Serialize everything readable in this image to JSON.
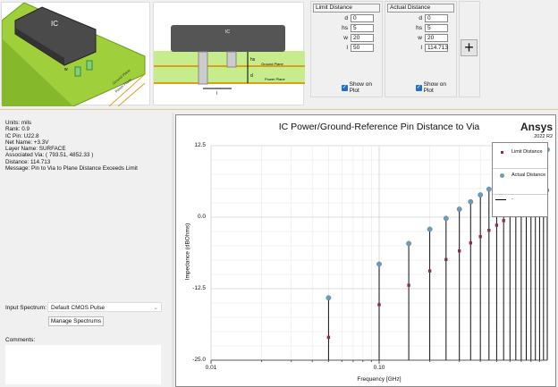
{
  "images": {
    "ic_label": "IC",
    "ground_plane": "Ground Plane",
    "power_plane": "Power Plane",
    "w": "w",
    "hs": "hs",
    "d": "d",
    "l": "l"
  },
  "limit_distance": {
    "title": "Limit Distance",
    "fields": [
      {
        "label": "d",
        "value": "0"
      },
      {
        "label": "hs",
        "value": "5"
      },
      {
        "label": "w",
        "value": "20"
      },
      {
        "label": "l",
        "value": "50"
      }
    ],
    "show_on_plot": "Show on Plot",
    "checked": true
  },
  "actual_distance": {
    "title": "Actual Distance",
    "fields": [
      {
        "label": "d",
        "value": "0"
      },
      {
        "label": "hs",
        "value": "5"
      },
      {
        "label": "w",
        "value": "20"
      },
      {
        "label": "l",
        "value": "114.713"
      }
    ],
    "show_on_plot": "Show on Plot",
    "checked": true
  },
  "add_button": {
    "icon": "plus-icon",
    "label": "+"
  },
  "info": [
    "Units: mils",
    "Rank: 0.9",
    "IC Pin: U22.8",
    "Net Name: +3.3V",
    "Layer Name: SURFACE",
    "Associated Via: ( 793.51, 4852.33 )",
    "Distance: 114.713",
    "Message: Pin to Via to Plane Distance Exceeds Limit"
  ],
  "input_spectrum": {
    "label": "Input Spectrum:",
    "value": "Default CMOS Pulse"
  },
  "manage_button": "Manage Spectrums",
  "comments": {
    "label": "Comments:",
    "value": ""
  },
  "brand": {
    "name": "Ansys",
    "version": "2022 R2"
  },
  "chart_data": {
    "type": "scatter",
    "title": "IC Power/Ground-Reference Pin Distance to Via",
    "xlabel": "Frequency [GHz]",
    "ylabel": "Impedance (dBOhms)",
    "xscale": "log",
    "xlim": [
      0.01,
      1.0
    ],
    "ylim": [
      -25,
      12.5
    ],
    "xticks": [
      "0.01",
      "0.10"
    ],
    "yticks": [
      "12.5",
      "0.0",
      "-12.5",
      "-25.0"
    ],
    "grid": true,
    "legend_position": "top-right",
    "x": [
      0.05,
      0.1,
      0.15,
      0.2,
      0.25,
      0.3,
      0.35,
      0.4,
      0.45,
      0.5,
      0.55,
      0.6,
      0.65,
      0.7,
      0.75,
      0.8,
      0.85,
      0.9,
      0.95,
      1.0
    ],
    "series": [
      {
        "name": "Limit Distance",
        "color": "#8b2e4a",
        "marker": "square",
        "values": [
          -21.0,
          -15.3,
          -11.9,
          -9.4,
          -7.4,
          -5.9,
          -4.5,
          -3.4,
          -2.3,
          -1.4,
          -0.6,
          0.3,
          1.0,
          1.6,
          2.2,
          2.8,
          3.3,
          3.8,
          4.2,
          4.7
        ]
      },
      {
        "name": "Actual Distance",
        "color": "#6f9bb5",
        "marker": "circle",
        "values": [
          -14.1,
          -8.2,
          -4.6,
          -2.1,
          -0.2,
          1.4,
          2.7,
          3.9,
          4.9,
          5.7,
          6.5,
          7.4,
          8.1,
          8.7,
          9.3,
          9.9,
          10.4,
          10.9,
          11.3,
          11.8
        ]
      },
      {
        "name": "-",
        "color": "#000000",
        "marker": "line"
      }
    ]
  }
}
